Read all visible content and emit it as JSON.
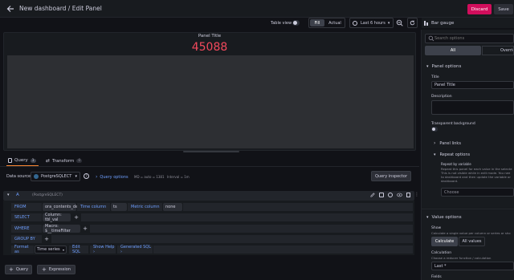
{
  "header": {
    "title": "New dashboard / Edit Panel",
    "discard": "Discard",
    "save": "Save"
  },
  "toolbar": {
    "table_view": "Table view",
    "fill": "Fill",
    "actual": "Actual",
    "time_range": "Last 6 hours",
    "viz_name": "Bar gauge"
  },
  "panel": {
    "title": "Panel Title",
    "value": "45088"
  },
  "tabs": {
    "query": "Query",
    "query_count": "1",
    "transform": "Transform",
    "transform_count": "0"
  },
  "datasource": {
    "label": "Data source",
    "name": "PostgreSQLECT",
    "query_options": "Query options",
    "meta": "MD = auto = 1381",
    "interval": "Interval = 1m",
    "inspector": "Query inspector"
  },
  "query": {
    "ref": "A",
    "source": "(PostgreSQLECT)",
    "from_label": "FROM",
    "from_table": "ora_contents_delta",
    "time_column_label": "Time column",
    "time_column": "ts",
    "metric_column_label": "Metric column",
    "metric_column": "none",
    "select_label": "SELECT",
    "select_value": "Column: tbl_val",
    "where_label": "WHERE",
    "where_value": "Macro: $__timeFilter",
    "group_label": "GROUP BY",
    "format_label": "Format as",
    "format_value": "Time series",
    "edit_sql": "Edit SQL",
    "show_help": "Show Help ›",
    "generated_sql": "Generated SQL ›",
    "add_query": "Query",
    "add_expression": "Expression"
  },
  "options": {
    "search_placeholder": "Search options",
    "tab_all": "All",
    "tab_overrides": "Overrides",
    "panel_options": "Panel options",
    "title_label": "Title",
    "title_value": "Panel Title",
    "description_label": "Description",
    "transparent_label": "Transparent background",
    "panel_links": "Panel links",
    "repeat_options": "Repeat options",
    "repeat_by_label": "Repeat by variable",
    "repeat_desc_1": "Repeat this panel for each value in the selecte",
    "repeat_desc_2": "This is not visible while in edit mode. You nee",
    "repeat_desc_3": "to dashboard and then update the variable or",
    "repeat_desc_4": "dashboard.",
    "choose": "Choose",
    "value_options": "Value options",
    "show_label": "Show",
    "show_desc": "Calculate a single value per column or series or sho",
    "calculate": "Calculate",
    "all_values": "All values",
    "calculation_label": "Calculation",
    "calculation_desc": "Choose a reducer function / calculation",
    "calculation_value": "Last *",
    "fields_label": "Fields"
  },
  "colors": {
    "bg": "#111217",
    "panel": "#181b1f",
    "accent_blue": "#6e9fff",
    "value_red": "#f2495c",
    "discard_red": "#d10e5c"
  }
}
